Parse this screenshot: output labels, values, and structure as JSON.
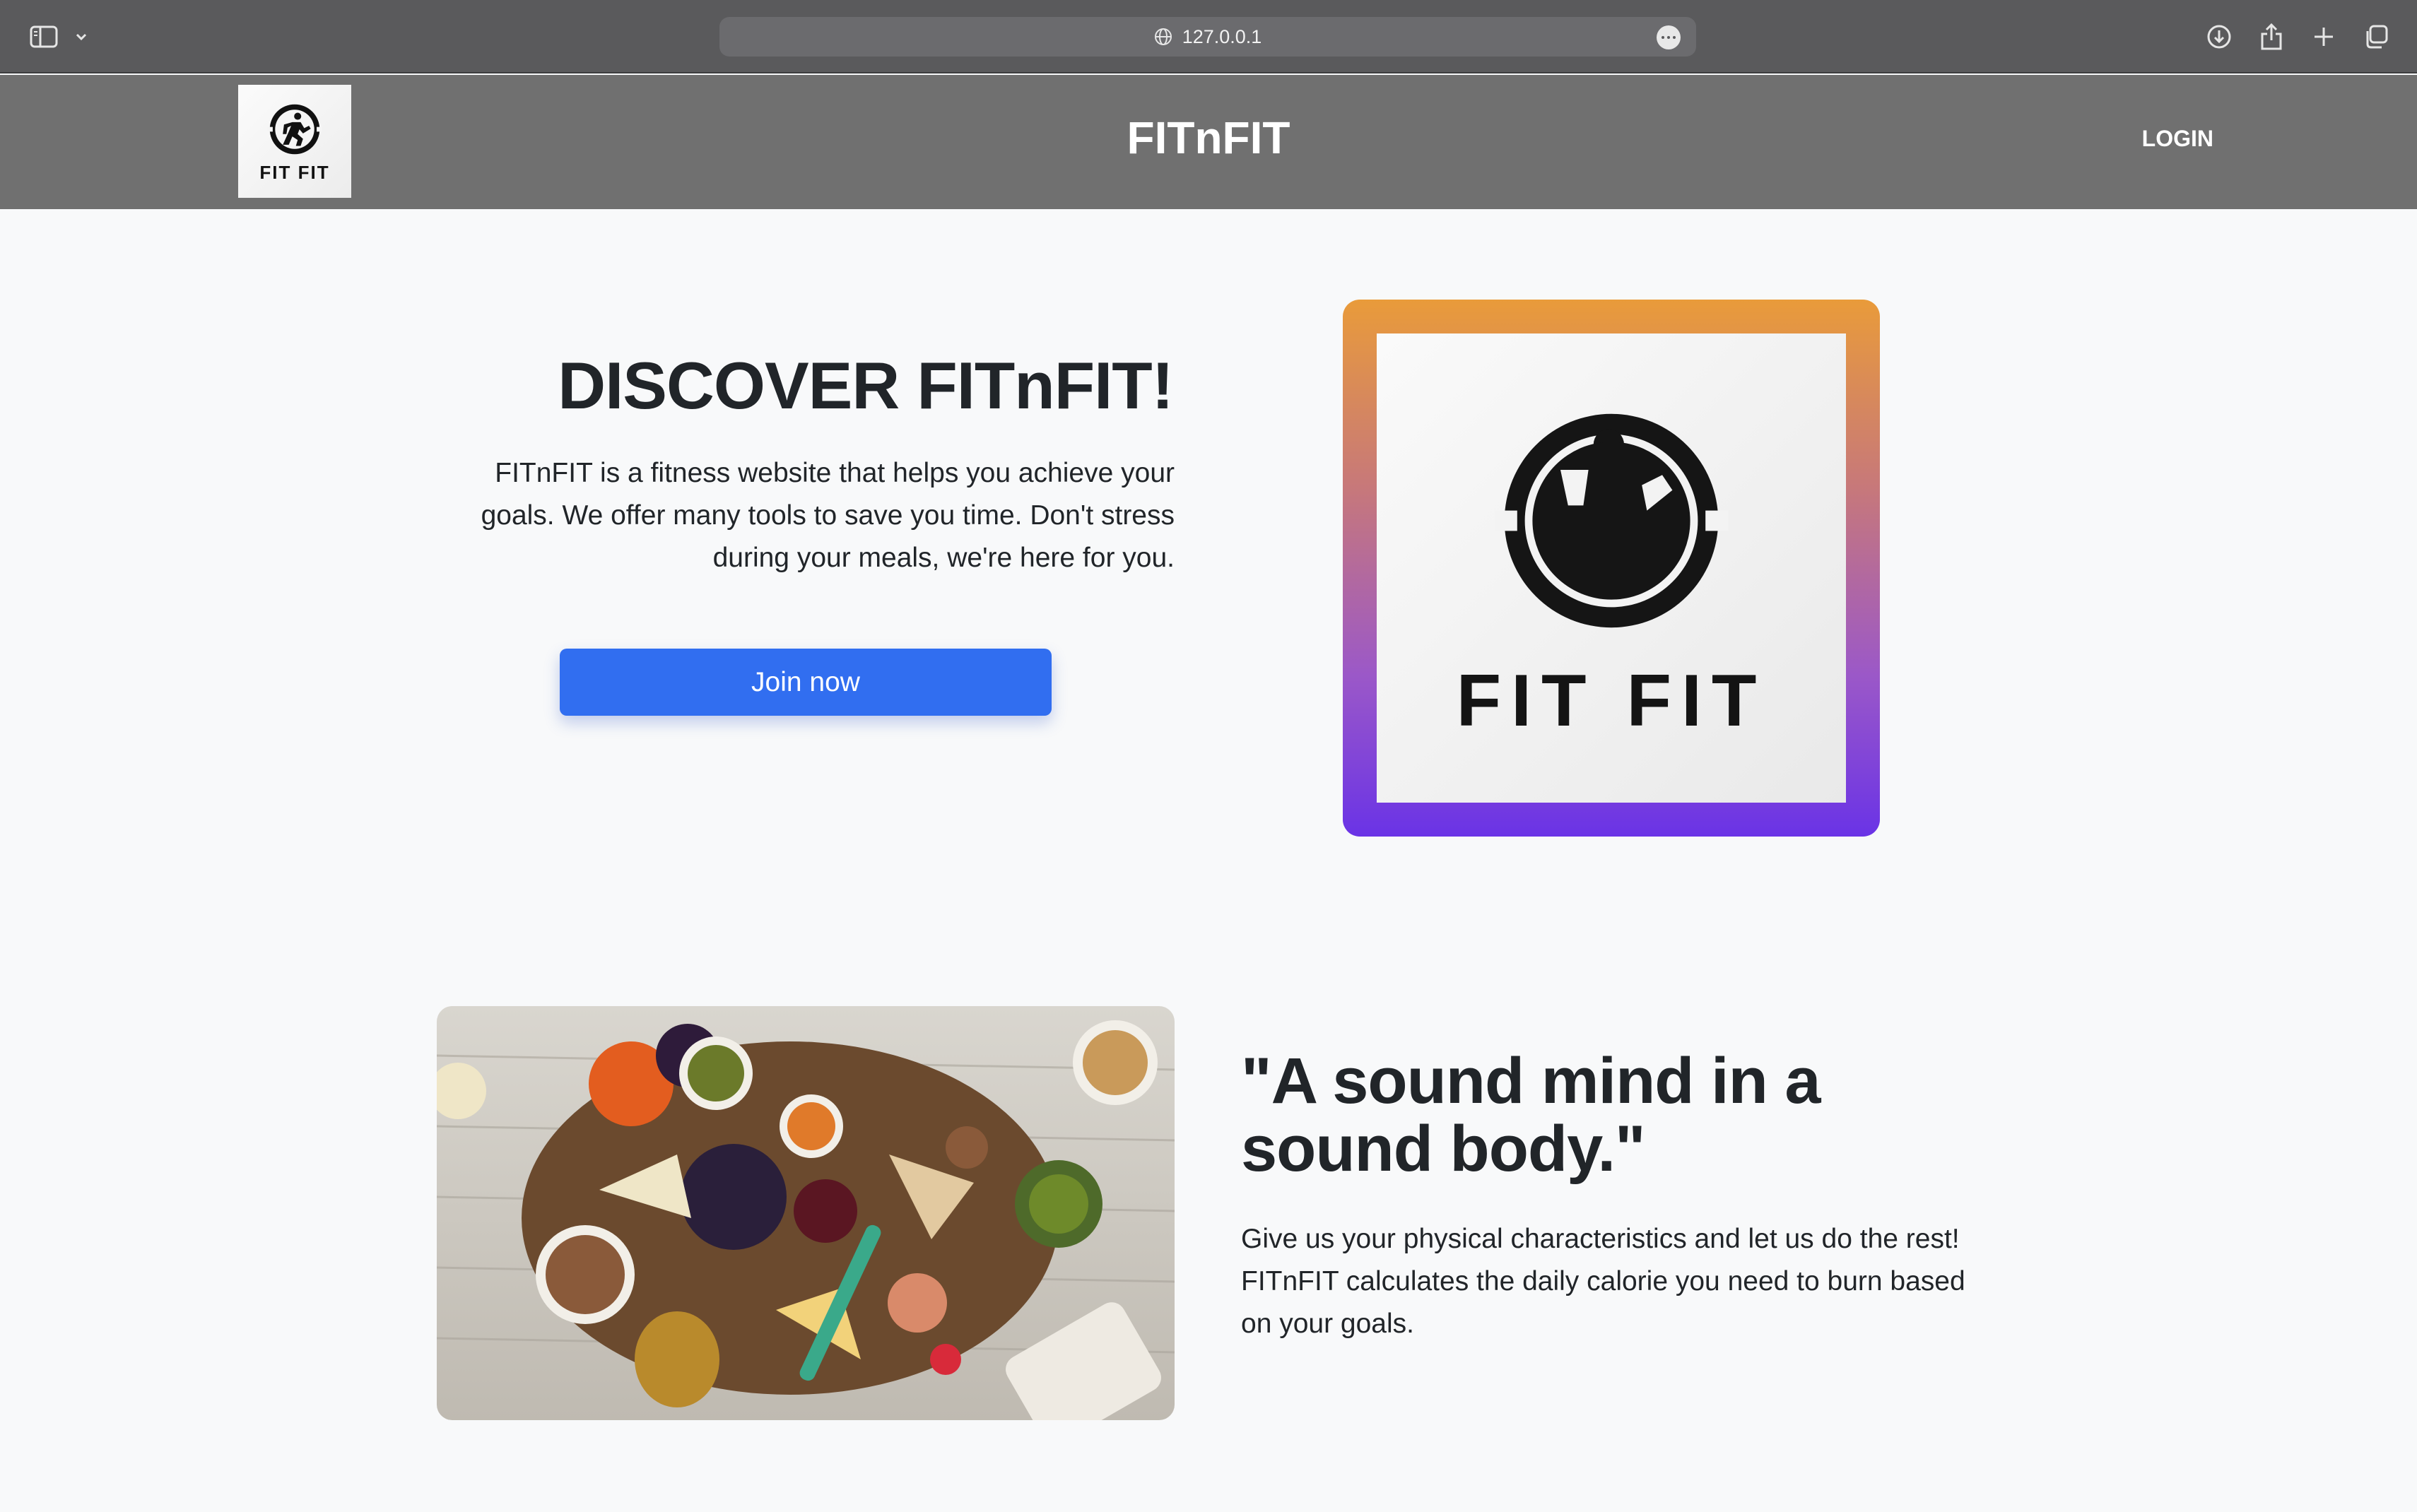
{
  "browser": {
    "url": "127.0.0.1",
    "icons": [
      "sidebar-icon",
      "chevron-down-icon",
      "globe-icon",
      "more-icon",
      "download-icon",
      "share-icon",
      "plus-icon",
      "tabs-icon"
    ]
  },
  "header": {
    "logo_text": "FIT FIT",
    "title": "FITnFIT",
    "login_label": "LOGIN",
    "background": "#707070"
  },
  "hero": {
    "heading": "DISCOVER FITnFIT!",
    "text": "FITnFIT is a fitness website that helps you achieve your goals. We offer many tools to save you time. Don't stress during your meals, we're here for you.",
    "button_label": "Join now",
    "button_color": "#316ef0",
    "image_logo_text": "FIT FIT",
    "frame_gradient": [
      "#e99b3a",
      "#6a33e6"
    ]
  },
  "section2": {
    "quote": "\"A sound mind in a sound body.\"",
    "text": "Give us your physical characteristics and let us do the rest! FITnFIT calculates the daily calorie you need to burn based on your goals."
  }
}
